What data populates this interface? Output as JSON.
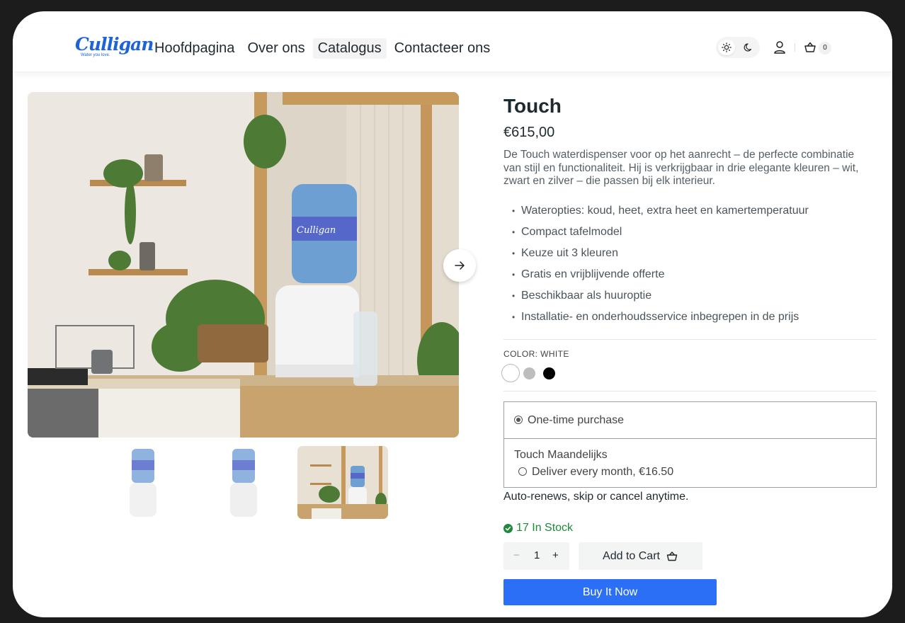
{
  "brand": {
    "name": "Culligan",
    "tagline": "Water you love."
  },
  "nav": {
    "items": [
      {
        "label": "Hoofdpagina",
        "active": false
      },
      {
        "label": "Over ons",
        "active": false
      },
      {
        "label": "Catalogus",
        "active": true
      },
      {
        "label": "Contacteer ons",
        "active": false
      }
    ]
  },
  "header": {
    "theme_light_icon": "sun-icon",
    "theme_dark_icon": "moon-icon",
    "account_icon": "user-icon",
    "cart_icon": "basket-icon",
    "cart_count": "0"
  },
  "gallery": {
    "thumbnail_count": 3,
    "selected_thumbnail": 3
  },
  "product": {
    "title": "Touch",
    "price": "€615,00",
    "description": "De Touch waterdispenser voor op het aanrecht – de perfecte combinatie van stijl en functionaliteit. Hij is verkrijgbaar in drie elegante kleuren – wit, zwart en zilver – die passen bij elk interieur.",
    "features": [
      "Wateropties: koud, heet, extra heet en kamertemperatuur",
      "Compact tafelmodel",
      "Keuze uit 3 kleuren",
      "Gratis en vrijblijvende offerte",
      "Beschikbaar als huuroptie",
      "Installatie- en onderhoudsservice inbegrepen in de prijs"
    ],
    "color_label": "COLOR: WHITE",
    "colors": [
      {
        "name": "white",
        "hex": "#ffffff",
        "selected": true
      },
      {
        "name": "silver",
        "hex": "#bdbdbd",
        "selected": false
      },
      {
        "name": "black",
        "hex": "#000000",
        "selected": false
      }
    ]
  },
  "purchase": {
    "one_time_label": "One-time purchase",
    "subscription_title": "Touch Maandelijks",
    "subscription_option": "Deliver every month, €16.50",
    "renew_note": "Auto-renews, skip or cancel anytime.",
    "stock_text": "17 In Stock",
    "quantity": "1",
    "minus": "−",
    "plus": "+",
    "add_to_cart": "Add to Cart",
    "buy_now": "Buy It Now"
  },
  "colors": {
    "accent": "#2a6ff5",
    "stock": "#1c8a3a",
    "brand": "#1e64d6"
  }
}
